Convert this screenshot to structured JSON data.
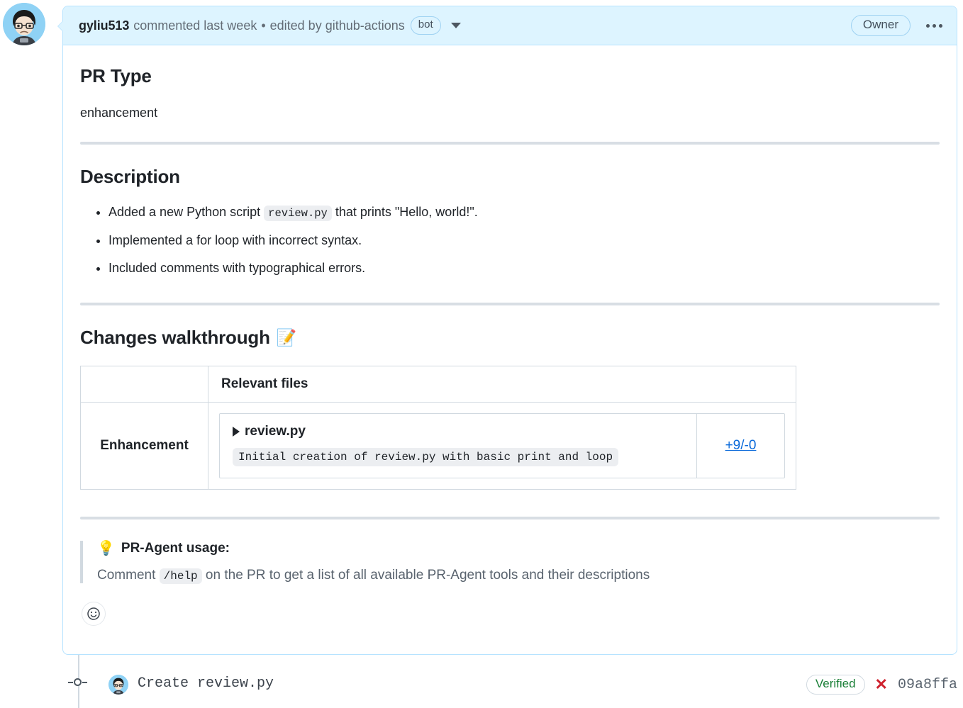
{
  "comment": {
    "author": "gyliu513",
    "action": "commented last week",
    "separator": "•",
    "edited_by": "edited by github-actions",
    "bot_badge": "bot",
    "caret_icon": "chevron-down-icon",
    "owner_badge": "Owner",
    "kebab_icon": "kebab-horizontal-icon"
  },
  "sections": {
    "pr_type": {
      "heading": "PR Type",
      "value": "enhancement"
    },
    "description": {
      "heading": "Description",
      "bullets": [
        {
          "pre": "Added a new Python script ",
          "code": "review.py",
          "post": " that prints \"Hello, world!\"."
        },
        {
          "pre": "Implemented a for loop with incorrect syntax.",
          "code": "",
          "post": ""
        },
        {
          "pre": "Included comments with typographical errors.",
          "code": "",
          "post": ""
        }
      ]
    },
    "walkthrough": {
      "heading": "Changes walkthrough",
      "emoji": "📝",
      "emoji_name": "memo-emoji",
      "table": {
        "headers": [
          "",
          "Relevant files"
        ],
        "rows": [
          {
            "category": "Enhancement",
            "file_name": "review.py",
            "file_desc": "Initial creation of review.py with basic print and loop",
            "diff": "+9/-0",
            "disclosure_icon": "triangle-right-icon"
          }
        ]
      }
    },
    "usage": {
      "emoji": "💡",
      "emoji_name": "light-bulb-emoji",
      "title": "PR-Agent usage:",
      "text_before": "Comment ",
      "code": "/help",
      "text_after": " on the PR to get a list of all available PR-Agent tools and their descriptions"
    }
  },
  "reaction": {
    "icon": "smiley-face-icon",
    "label": "Add reaction"
  },
  "commit": {
    "message": "Create review.py",
    "verified_badge": "Verified",
    "status_icon": "x-mark-icon",
    "sha": "09a8ffa"
  },
  "colors": {
    "header_bg": "#ddf4ff",
    "header_border": "#b6e3ff",
    "link": "#0969da",
    "verified_green": "#1a7f37",
    "error_red": "#cf222e",
    "muted_text": "#59636e"
  }
}
